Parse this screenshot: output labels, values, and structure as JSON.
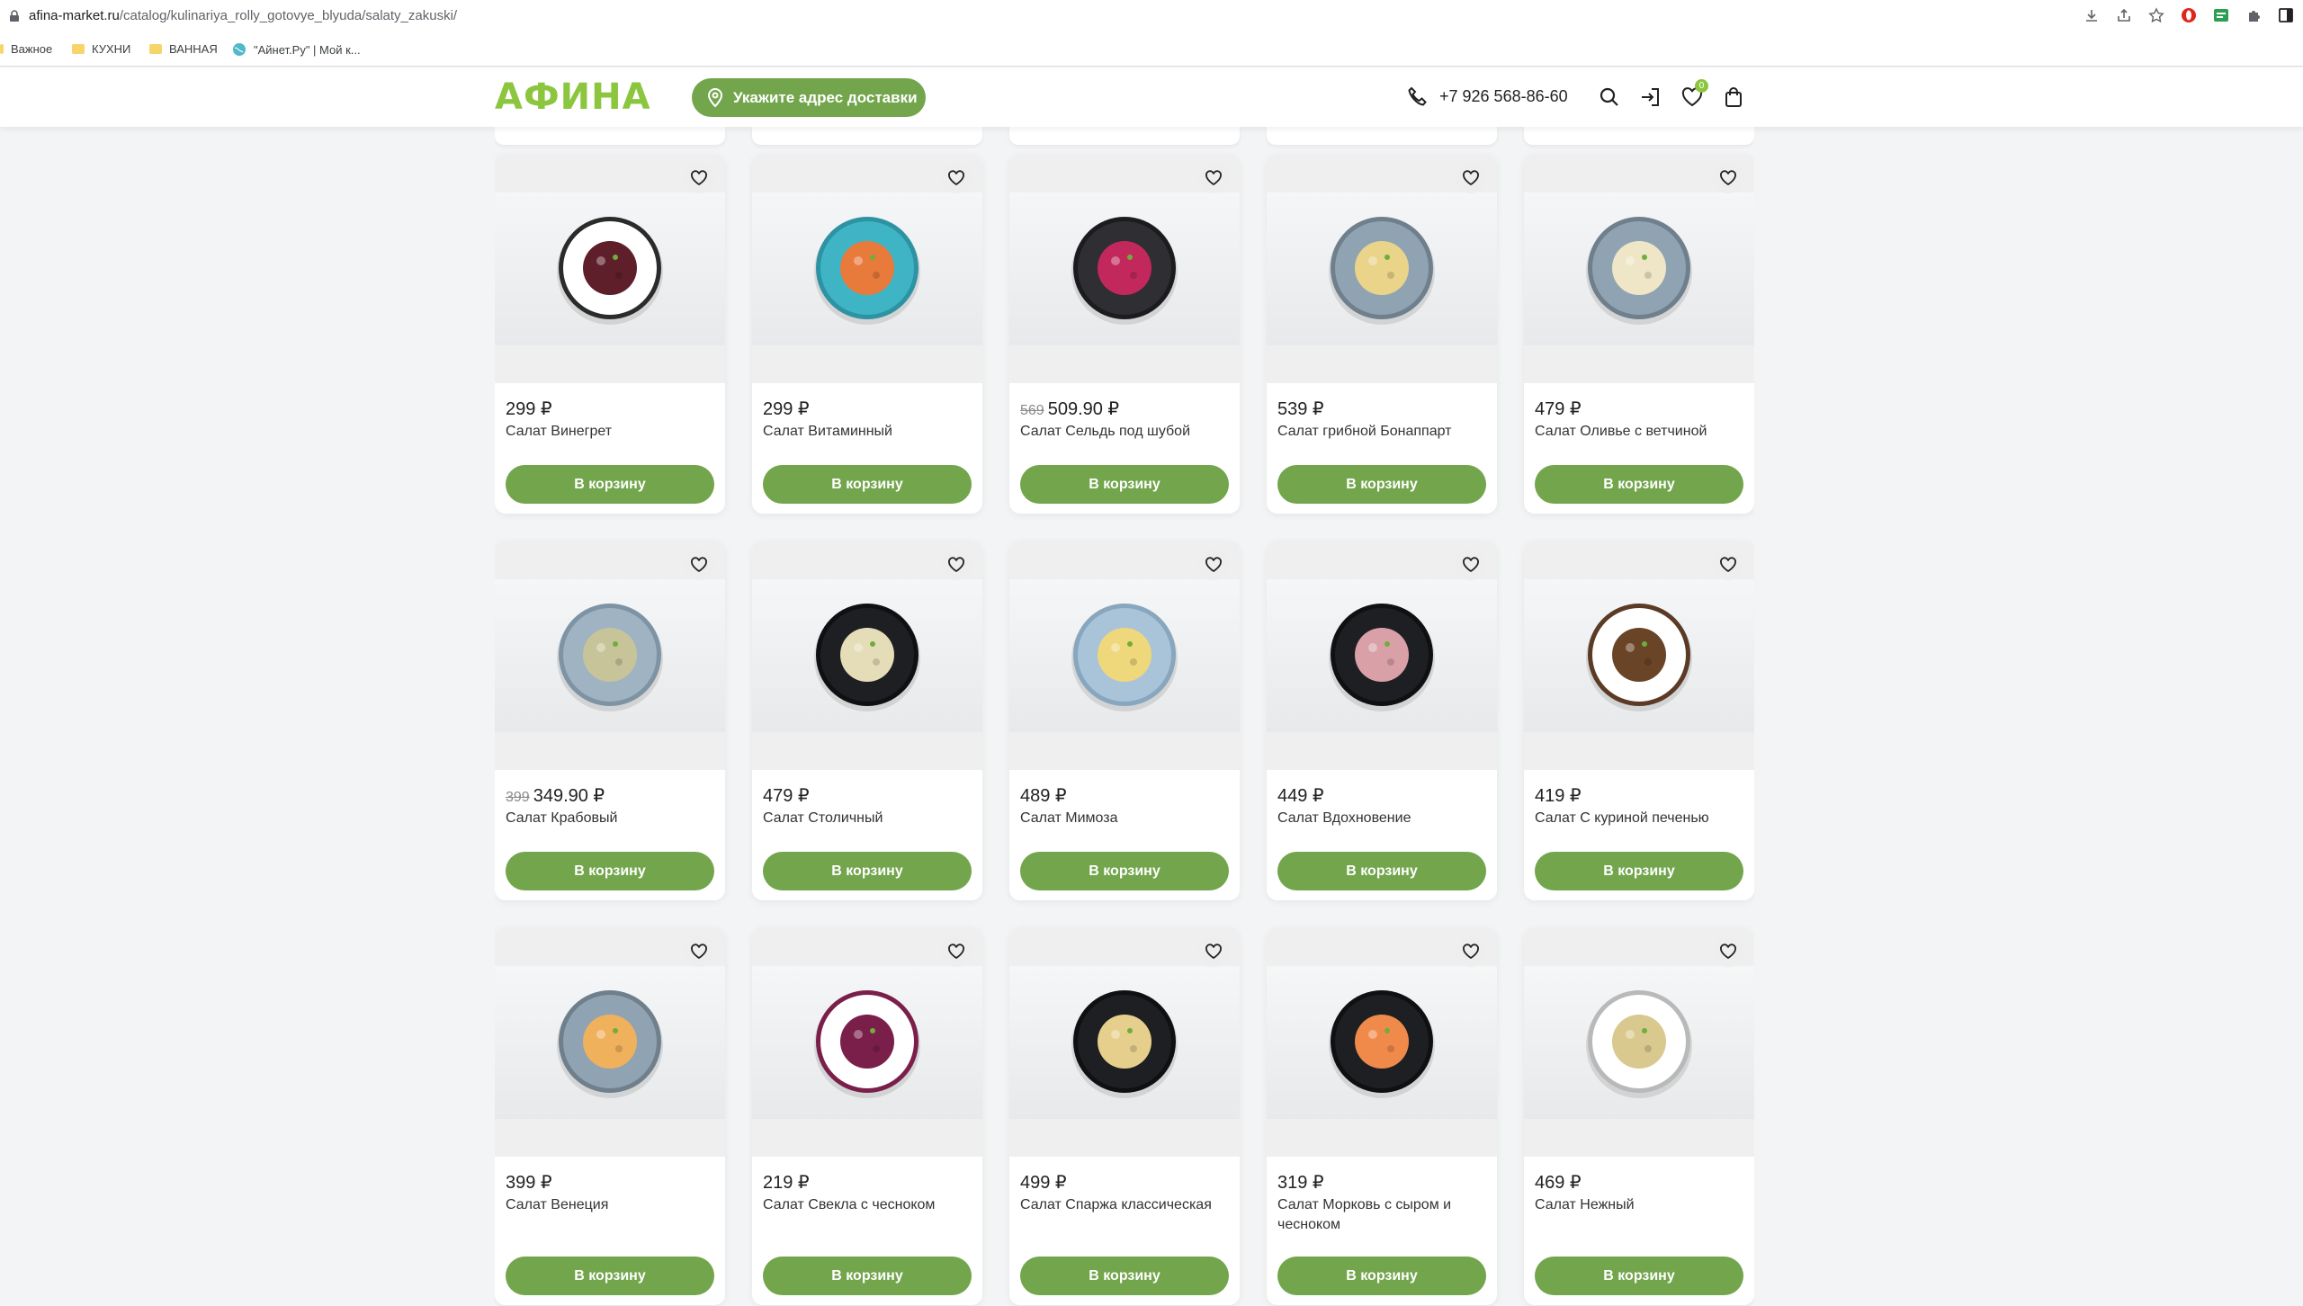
{
  "browser": {
    "url_domain": "afina-market.ru",
    "url_path": "/catalog/kulinariya_rolly_gotovye_blyuda/salaty_zakuski/",
    "bookmarks": [
      "Важное",
      "КУХНИ",
      "ВАННАЯ",
      "\"Айнет.Ру\" | Мой к..."
    ]
  },
  "header": {
    "logo": "АФИНА",
    "address_button": "Укажите адрес доставки",
    "phone": "+7 926 568-86-60",
    "favorites_count": "0"
  },
  "colors": {
    "accent": "#72a54c",
    "logo": "#8cc63f"
  },
  "products": [
    {
      "price": "299 ₽",
      "old_price": "",
      "name": "Салат Винегрет",
      "button": "В корзину",
      "plate": "#ffffff",
      "rim": "#2b2b2b",
      "food": "#5e1f2a"
    },
    {
      "price": "299 ₽",
      "old_price": "",
      "name": "Салат Витаминный",
      "button": "В корзину",
      "plate": "#3fb4c4",
      "rim": "#2d93a3",
      "food": "#e87a3c"
    },
    {
      "price": "509.90 ₽",
      "old_price": "569",
      "name": "Салат Сельдь под шубой",
      "button": "В корзину",
      "plate": "#2e2e33",
      "rim": "#1c1c1f",
      "food": "#c2285c"
    },
    {
      "price": "539 ₽",
      "old_price": "",
      "name": "Салат грибной Бонаппарт",
      "button": "В корзину",
      "plate": "#8fa3b3",
      "rim": "#6f7f8c",
      "food": "#e9d48a"
    },
    {
      "price": "479 ₽",
      "old_price": "",
      "name": "Салат Оливье с ветчиной",
      "button": "В корзину",
      "plate": "#8fa3b3",
      "rim": "#6f7f8c",
      "food": "#efe6c7"
    },
    {
      "price": "349.90 ₽",
      "old_price": "399",
      "name": "Салат Крабовый",
      "button": "В корзину",
      "plate": "#9fb3c2",
      "rim": "#7e93a3",
      "food": "#c8c49a"
    },
    {
      "price": "479 ₽",
      "old_price": "",
      "name": "Салат Столичный",
      "button": "В корзину",
      "plate": "#1e1f22",
      "rim": "#0f1012",
      "food": "#e5dcb8"
    },
    {
      "price": "489 ₽",
      "old_price": "",
      "name": "Салат Мимоза",
      "button": "В корзину",
      "plate": "#a9c4d9",
      "rim": "#88a6bd",
      "food": "#efd77b"
    },
    {
      "price": "449 ₽",
      "old_price": "",
      "name": "Салат Вдохновение",
      "button": "В корзину",
      "plate": "#1e1f22",
      "rim": "#0f1012",
      "food": "#d9a0a8"
    },
    {
      "price": "419 ₽",
      "old_price": "",
      "name": "Салат С куриной печенью",
      "button": "В корзину",
      "plate": "#ffffff",
      "rim": "#5b3a26",
      "food": "#6a4426"
    },
    {
      "price": "399 ₽",
      "old_price": "",
      "name": "Салат Венеция",
      "button": "В корзину",
      "plate": "#8fa3b3",
      "rim": "#6f7f8c",
      "food": "#f0b15c"
    },
    {
      "price": "219 ₽",
      "old_price": "",
      "name": "Салат Свекла с чесноком",
      "button": "В корзину",
      "plate": "#ffffff",
      "rim": "#7a1f4a",
      "food": "#7a1f4a"
    },
    {
      "price": "499 ₽",
      "old_price": "",
      "name": "Салат Спаржа классическая",
      "button": "В корзину",
      "plate": "#1e1f22",
      "rim": "#0f1012",
      "food": "#e6cf8c"
    },
    {
      "price": "319 ₽",
      "old_price": "",
      "name": "Салат Морковь с сыром и чесноком",
      "button": "В корзину",
      "plate": "#1e1f22",
      "rim": "#0f1012",
      "food": "#f08a4a"
    },
    {
      "price": "469 ₽",
      "old_price": "",
      "name": "Салат Нежный",
      "button": "В корзину",
      "plate": "#ffffff",
      "rim": "#b9b9b9",
      "food": "#d9c98f"
    }
  ]
}
